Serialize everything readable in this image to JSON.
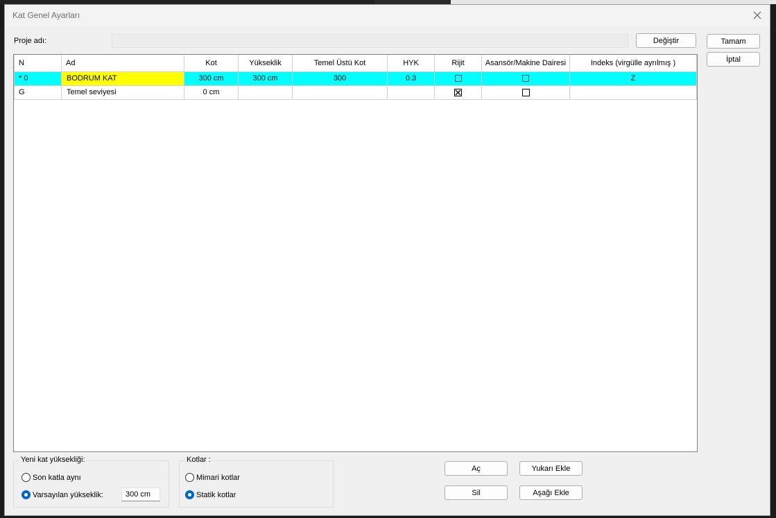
{
  "window": {
    "title": "Kat Genel Ayarları"
  },
  "project": {
    "label": "Proje adı:",
    "value": "",
    "change_button": "Değiştir"
  },
  "actions": {
    "ok": "Tamam",
    "cancel": "İptal"
  },
  "table": {
    "columns": [
      "N",
      "Ad",
      "Kot",
      "Yükseklik",
      "Temel Üstü Kot",
      "HYK",
      "Rijit",
      "Asansör/Makine Dairesi",
      "Indeks (virgülle ayrılmış )"
    ],
    "rows": [
      {
        "n": "* 0",
        "ad": "BODRUM KAT",
        "kot": "300 cm",
        "yukseklik": "300 cm",
        "temel_ustu_kot": "300",
        "hyk": "0.3",
        "rijit": false,
        "asansor": false,
        "indeks": "Z",
        "selected": true
      },
      {
        "n": "G",
        "ad": "Temel seviyesi",
        "kot": "0 cm",
        "yukseklik": "",
        "temel_ustu_kot": "",
        "hyk": "",
        "rijit": true,
        "asansor": false,
        "indeks": "",
        "selected": false
      }
    ]
  },
  "new_floor_height": {
    "legend": "Yeni kat yüksekliği:",
    "option_same": "Son katla aynı",
    "option_default": "Varsayılan yükseklik:",
    "default_value": "300 cm",
    "selected": "default"
  },
  "levels": {
    "legend": "Kotlar :",
    "option_arch": "Mimari kotlar",
    "option_static": "Statik kotlar",
    "selected": "static"
  },
  "floor_buttons": {
    "open": "Aç",
    "delete": "Sil",
    "add_above": "Yukarı Ekle",
    "add_below": "Aşağı Ekle"
  },
  "colors": {
    "selected_row": "#00ffff",
    "selected_name": "#ffff00",
    "accent": "#0067c0"
  }
}
